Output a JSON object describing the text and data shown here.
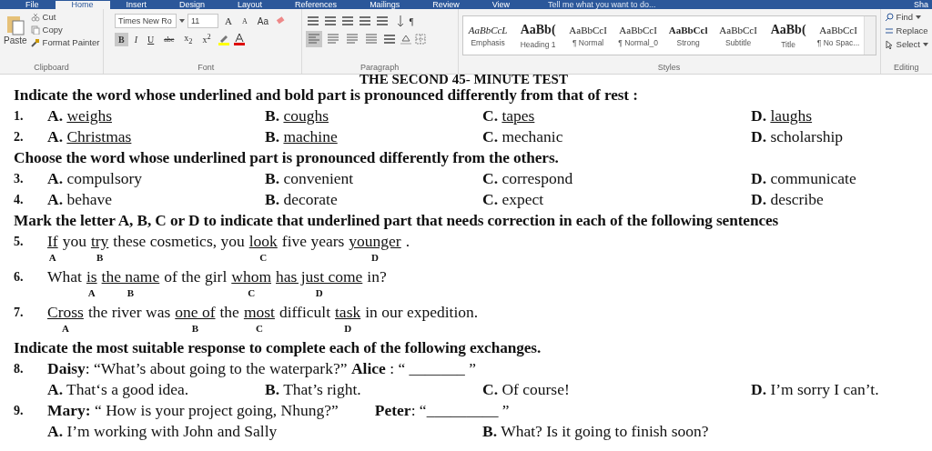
{
  "tabs": [
    {
      "label": "File",
      "selected": false
    },
    {
      "label": "Home",
      "selected": true
    },
    {
      "label": "Insert",
      "selected": false
    },
    {
      "label": "Design",
      "selected": false
    },
    {
      "label": "Layout",
      "selected": false
    },
    {
      "label": "References",
      "selected": false
    },
    {
      "label": "Mailings",
      "selected": false
    },
    {
      "label": "Review",
      "selected": false
    },
    {
      "label": "View",
      "selected": false
    }
  ],
  "tell_me": "Tell me what you want to do...",
  "share": "Sha",
  "clipboard": {
    "paste": "Paste",
    "cut": "Cut",
    "copy": "Copy",
    "format_painter": "Format Painter",
    "label": "Clipboard"
  },
  "font": {
    "family": "Times New Ro",
    "size": "11",
    "grow": "A",
    "shrink": "A",
    "case_button": "Aa",
    "label": "Font",
    "format_buttons": [
      {
        "text": "B",
        "kind": "bold",
        "selected": true
      },
      {
        "text": "I",
        "kind": "italic",
        "selected": false
      },
      {
        "text": "U",
        "kind": "underline",
        "selected": false
      },
      {
        "text": "abc",
        "kind": "strike",
        "selected": false
      },
      {
        "text": "x$_{2}$",
        "kind": "plain",
        "selected": false
      },
      {
        "text": "x$^{2}$",
        "kind": "plain",
        "selected": false
      }
    ]
  },
  "paragraph": {
    "label": "Paragraph",
    "pilcrow": "¶",
    "alignments": [
      {
        "selected": true
      },
      {
        "selected": false
      },
      {
        "selected": false
      },
      {
        "selected": false
      }
    ]
  },
  "styles": {
    "label": "Styles",
    "items": [
      {
        "sample": "AaBbCcL",
        "name": "Emphasis",
        "kind": "italic"
      },
      {
        "sample": "AaBb(",
        "name": "Heading 1",
        "kind": "heading"
      },
      {
        "sample": "AaBbCcI",
        "name": "¶ Normal",
        "kind": "normal"
      },
      {
        "sample": "AaBbCcI",
        "name": "¶ Normal_0",
        "kind": "normal"
      },
      {
        "sample": "AaBbCcl",
        "name": "Strong",
        "kind": "strong"
      },
      {
        "sample": "AaBbCcI",
        "name": "Subtitle",
        "kind": "normal"
      },
      {
        "sample": "AaBb(",
        "name": "Title",
        "kind": "heading"
      },
      {
        "sample": "AaBbCcI",
        "name": "¶ No Spac...",
        "kind": "normal"
      }
    ]
  },
  "editing": {
    "find": "Find",
    "replace": "Replace",
    "select": "Select",
    "label": "Editing"
  },
  "document": {
    "title": "THE SECOND 45- MINUTE TEST",
    "blocks": [
      {
        "kind": "heading",
        "text": "Indicate the word whose underlined and bold part is pronounced differently from that of rest :"
      },
      {
        "kind": "options",
        "number": "1.",
        "options": [
          {
            "letter": "A.",
            "text": "weighs",
            "underline": true
          },
          {
            "letter": "B.",
            "text": "coughs",
            "underline": true
          },
          {
            "letter": "C.",
            "text": "tapes",
            "underline": true
          },
          {
            "letter": "D.",
            "text": "laughs",
            "underline": true
          }
        ]
      },
      {
        "kind": "options",
        "number": "2.",
        "options": [
          {
            "letter": "A.",
            "text": "Christmas",
            "underline": true
          },
          {
            "letter": "B.",
            "text": "machine",
            "underline": true
          },
          {
            "letter": "C.",
            "text": "mechanic",
            "underline": false
          },
          {
            "letter": "D.",
            "text": "scholarship",
            "underline": false
          }
        ]
      },
      {
        "kind": "heading",
        "text": "Choose the word whose underlined part is pronounced differently from the others."
      },
      {
        "kind": "options",
        "number": "3.",
        "options": [
          {
            "letter": "A.",
            "text": "compulsory",
            "underline": false
          },
          {
            "letter": "B.",
            "text": "convenient",
            "underline": false
          },
          {
            "letter": "C.",
            "text": "correspond",
            "underline": false
          },
          {
            "letter": "D.",
            "text": "communicate",
            "underline": false
          }
        ]
      },
      {
        "kind": "options",
        "number": "4.",
        "options": [
          {
            "letter": "A.",
            "text": "behave",
            "underline": false
          },
          {
            "letter": "B.",
            "text": "decorate",
            "underline": false
          },
          {
            "letter": "C.",
            "text": "expect",
            "underline": false
          },
          {
            "letter": "D.",
            "text": "describe",
            "underline": false
          }
        ]
      },
      {
        "kind": "heading",
        "text": "Mark the letter A, B, C or D to indicate that underlined part that needs correction in each of the following sentences"
      },
      {
        "kind": "sentence",
        "number": "5.",
        "parts": [
          {
            "text": "If",
            "mark": "A"
          },
          {
            "text": "you"
          },
          {
            "text": "try",
            "mark": "B"
          },
          {
            "text": "these cosmetics, you"
          },
          {
            "text": "look",
            "mark": "C"
          },
          {
            "text": "five years"
          },
          {
            "text": "younger",
            "mark": "D"
          },
          {
            "text": "."
          }
        ]
      },
      {
        "kind": "sentence",
        "number": "6.",
        "parts": [
          {
            "text": "What"
          },
          {
            "text": "is",
            "mark": "A"
          },
          {
            "text": "the name",
            "mark": "B"
          },
          {
            "text": "of the girl"
          },
          {
            "text": "whom",
            "mark": "C"
          },
          {
            "text": "has just come",
            "mark": "D"
          },
          {
            "text": "in?"
          }
        ]
      },
      {
        "kind": "sentence",
        "number": "7.",
        "parts": [
          {
            "text": "Cross",
            "mark": "A"
          },
          {
            "text": "the river was"
          },
          {
            "text": "one of",
            "mark": "B"
          },
          {
            "text": "the"
          },
          {
            "text": "most",
            "mark": "C"
          },
          {
            "text": "difficult"
          },
          {
            "text": "task",
            "mark": "D"
          },
          {
            "text": "in our expedition."
          }
        ]
      },
      {
        "kind": "heading",
        "text": "Indicate the most suitable response to complete each of the following exchanges."
      },
      {
        "kind": "exchange",
        "number": "8.",
        "lines": [
          "**Daisy**: “What’s about going to the waterpark?” **Alice** : “ _______ ”"
        ]
      },
      {
        "kind": "options",
        "options": [
          {
            "letter": "A.",
            "text": "That‘s a good idea."
          },
          {
            "letter": "B.",
            "text": "That’s right."
          },
          {
            "letter": "C.",
            "text": "Of course!"
          },
          {
            "letter": "D.",
            "text": "I’m sorry I can’t."
          }
        ]
      },
      {
        "kind": "exchange",
        "number": "9.",
        "lines": [
          "**Mary:** “ How is your project going, Nhung?”",
          "**Peter**: “_________ ”"
        ]
      },
      {
        "kind": "options2",
        "options": [
          {
            "letter": "A.",
            "text": "I’m working with John and Sally"
          },
          {
            "letter": "B.",
            "text": "What? Is it going to finish soon?"
          }
        ]
      }
    ]
  }
}
